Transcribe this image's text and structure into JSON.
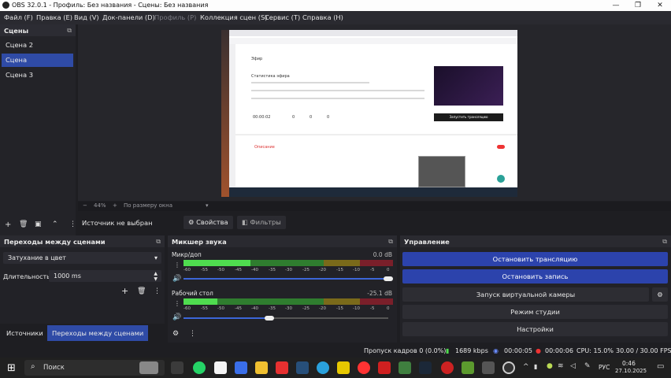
{
  "window": {
    "title": "OBS 32.0.1 - Профиль: Без названия - Сцены: Без названия",
    "minimize": "—",
    "maximize": "❐",
    "close": "✕"
  },
  "menu": [
    "Файл (F)",
    "Правка (E)",
    "Вид (V)",
    "Док-панели (D)",
    "Профиль (P)",
    "Коллекция сцен (S)",
    "Сервис (T)",
    "Справка (H)"
  ],
  "scenes": {
    "title": "Сцены",
    "items": [
      "Сцена 2",
      "Сцена",
      "Сцена 3"
    ],
    "selected_index": 1
  },
  "zoom": {
    "percent": "44%",
    "mode": "По размеру окна"
  },
  "source_bar": {
    "status": "Источник не выбран",
    "properties": "Свойства",
    "filters": "Фильтры"
  },
  "transitions": {
    "title": "Переходы между сценами",
    "type": "Затухание в цвет",
    "duration_label": "Длительность",
    "duration_value": "1000 ms"
  },
  "mixer": {
    "title": "Микшер звука",
    "channels": [
      {
        "name": "Микр/доп",
        "db": "0.0 dB",
        "level": 0.32,
        "volume": 1.0
      },
      {
        "name": "Рабочий стол",
        "db": "-25.1 dB",
        "level": 0.16,
        "volume": 0.42
      }
    ],
    "ticks": [
      "-60",
      "-55",
      "-50",
      "-45",
      "-40",
      "-35",
      "-30",
      "-25",
      "-20",
      "-15",
      "-10",
      "-5",
      "0"
    ]
  },
  "controls": {
    "title": "Управление",
    "stop_stream": "Остановить трансляцию",
    "stop_record": "Остановить запись",
    "virtual_cam": "Запуск виртуальной камеры",
    "studio_mode": "Режим студии",
    "settings": "Настройки"
  },
  "tabs": {
    "sources": "Источники",
    "transitions": "Переходы между сценами"
  },
  "status": {
    "dropped": "Пропуск кадров 0 (0.0%)",
    "bitrate": "1689 kbps",
    "stream_time": "00:00:05",
    "rec_time": "00:00:06",
    "cpu": "CPU: 15.0%",
    "fps": "30.00 / 30.00 FPS"
  },
  "taskbar": {
    "search": "Поиск",
    "lang": "РУС",
    "time": "0:46",
    "date": "27.10.2025"
  },
  "inner_page": {
    "heading": "Эфир",
    "live_status": "Статистика эфира",
    "counter": "00:00:02",
    "stat1": "0",
    "stat2": "0",
    "stat3": "0",
    "button": "Запустить трансляцию",
    "section": "Описание"
  },
  "colors": {
    "accent": "#2f4ba6",
    "button_blue": "#2c43ac",
    "panel": "#222227",
    "bg": "#1e1e22"
  }
}
